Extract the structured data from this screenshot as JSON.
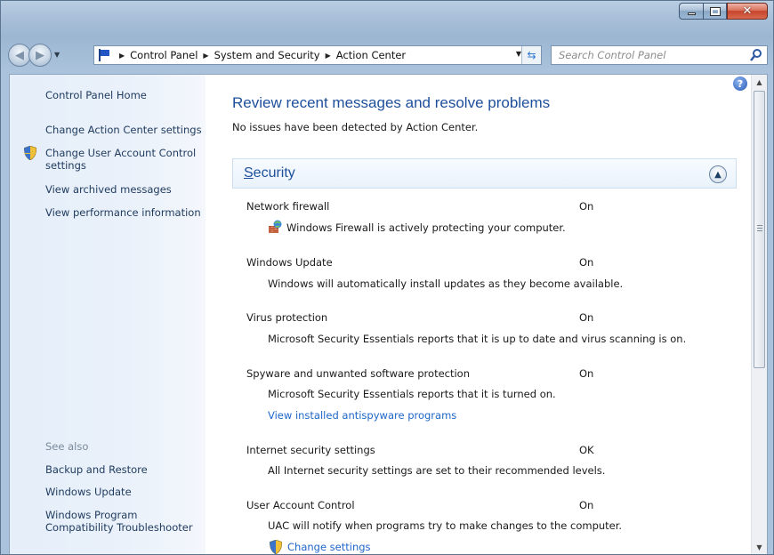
{
  "window": {
    "caption_buttons": {
      "minimize": "minimize",
      "maximize": "maximize",
      "close": "✕"
    }
  },
  "address_bar": {
    "breadcrumbs": [
      "Control Panel",
      "System and Security",
      "Action Center"
    ]
  },
  "search": {
    "placeholder": "Search Control Panel"
  },
  "sidebar": {
    "links": [
      "Control Panel Home",
      "Change Action Center settings",
      "Change User Account Control settings",
      "View archived messages",
      "View performance information"
    ],
    "see_also_label": "See also",
    "see_also_links": [
      "Backup and Restore",
      "Windows Update",
      "Windows Program Compatibility Troubleshooter"
    ]
  },
  "main": {
    "title": "Review recent messages and resolve problems",
    "subtitle": "No issues have been detected by Action Center.",
    "section": {
      "title_first": "S",
      "title_rest": "ecurity"
    },
    "items": [
      {
        "name": "Network firewall",
        "status": "On",
        "desc": "Windows Firewall is actively protecting your computer."
      },
      {
        "name": "Windows Update",
        "status": "On",
        "desc": "Windows will automatically install updates as they become available."
      },
      {
        "name": "Virus protection",
        "status": "On",
        "desc": "Microsoft Security Essentials reports that it is up to date and virus scanning is on."
      },
      {
        "name": "Spyware and unwanted software protection",
        "status": "On",
        "desc": "Microsoft Security Essentials reports that it is turned on.",
        "link": "View installed antispyware programs"
      },
      {
        "name": "Internet security settings",
        "status": "OK",
        "desc": "All Internet security settings are set to their recommended levels."
      },
      {
        "name": "User Account Control",
        "status": "On",
        "desc": "UAC will notify when programs try to make changes to the computer.",
        "link": "Change settings"
      }
    ]
  },
  "colors": {
    "link": "#1f66c9",
    "title": "#1e4f9b",
    "sidebar_text": "#1e3a5e"
  }
}
